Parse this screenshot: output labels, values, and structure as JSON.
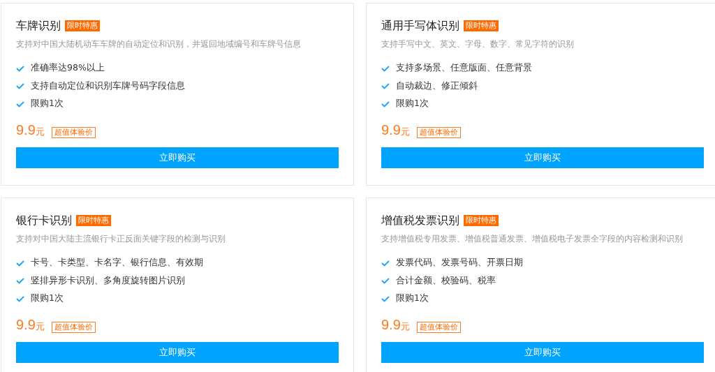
{
  "cards": [
    {
      "title": "车牌识别",
      "badge": "限时特惠",
      "description": "支持对中国大陆机动车车牌的自动定位和识别，并返回地域编号和车牌号信息",
      "features": [
        "准确率达98%以上",
        "支持自动定位和识别车牌号码字段信息",
        "限购1次"
      ],
      "price": "9.9",
      "unit": "元",
      "tag": "超值体验价",
      "button": "立即购买"
    },
    {
      "title": "通用手写体识别",
      "badge": "限时特惠",
      "description": "支持手写中文、英文、字母、数字、常见字符的识别",
      "features": [
        "支持多场景、任意版面、任意背景",
        "自动裁边、修正倾斜",
        "限购1次"
      ],
      "price": "9.9",
      "unit": "元",
      "tag": "超值体验价",
      "button": "立即购买"
    },
    {
      "title": "银行卡识别",
      "badge": "限时特惠",
      "description": "支持对中国大陆主流银行卡正反面关键字段的检测与识别",
      "features": [
        "卡号、卡类型、卡名字、银行信息、有效期",
        "竖排异形卡识别、多角度旋转图片识别",
        "限购1次"
      ],
      "price": "9.9",
      "unit": "元",
      "tag": "超值体验价",
      "button": "立即购买"
    },
    {
      "title": "增值税发票识别",
      "badge": "限时特惠",
      "description": "支持增值税专用发票、增值税普通发票、增值税电子发票全字段的内容检测和识别",
      "features": [
        "发票代码、发票号码、开票日期",
        "合计金额、校验码、税率",
        "限购1次"
      ],
      "price": "9.9",
      "unit": "元",
      "tag": "超值体验价",
      "button": "立即购买"
    }
  ]
}
